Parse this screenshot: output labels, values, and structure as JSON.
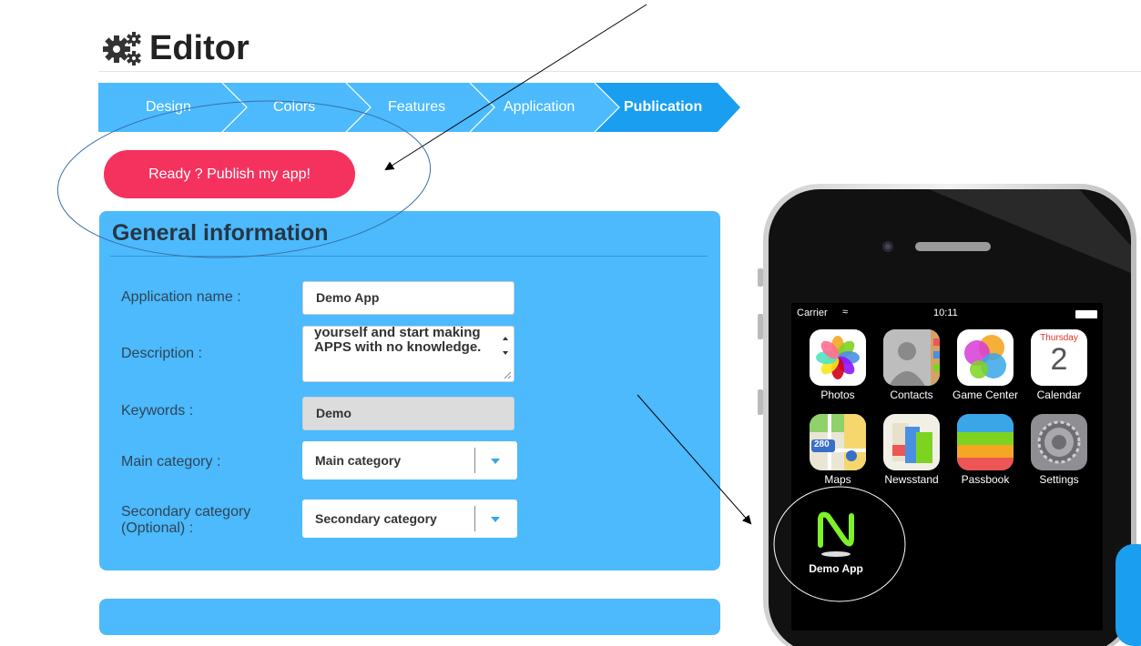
{
  "header": {
    "title": "Editor",
    "icon": "gears-icon"
  },
  "steps": [
    {
      "label": "Design",
      "active": false
    },
    {
      "label": "Colors",
      "active": false
    },
    {
      "label": "Features",
      "active": false
    },
    {
      "label": "Application",
      "active": false
    },
    {
      "label": "Publication",
      "active": true
    }
  ],
  "publish_button": "Ready ? Publish my app!",
  "panel": {
    "title": "General information",
    "fields": {
      "app_name": {
        "label": "Application name :",
        "value": "Demo App"
      },
      "description": {
        "label": "Description :",
        "value": "yourself and start making APPS with no knowledge."
      },
      "keywords": {
        "label": "Keywords :",
        "value": "Demo"
      },
      "main_category": {
        "label": "Main category :",
        "value": "Main category"
      },
      "secondary_category": {
        "label": "Secondary category (Optional) :",
        "value": "Secondary category"
      }
    }
  },
  "phone": {
    "carrier": "Carrier",
    "time": "10:11",
    "apps": [
      {
        "label": "Photos",
        "icon": "photos-icon"
      },
      {
        "label": "Contacts",
        "icon": "contacts-icon"
      },
      {
        "label": "Game Center",
        "icon": "game-center-icon"
      },
      {
        "label": "Calendar",
        "icon": "calendar-icon",
        "day": "Thursday",
        "date": "2"
      },
      {
        "label": "Maps",
        "icon": "maps-icon",
        "badge": "280"
      },
      {
        "label": "Newsstand",
        "icon": "newsstand-icon"
      },
      {
        "label": "Passbook",
        "icon": "passbook-icon"
      },
      {
        "label": "Settings",
        "icon": "settings-icon"
      },
      {
        "label": "Demo App",
        "icon": "demo-app-icon"
      }
    ]
  },
  "colors": {
    "accent_blue": "#4cbafd",
    "step_active": "#1a9ef0",
    "publish_pink": "#f5325e",
    "heading_dark": "#263645"
  }
}
